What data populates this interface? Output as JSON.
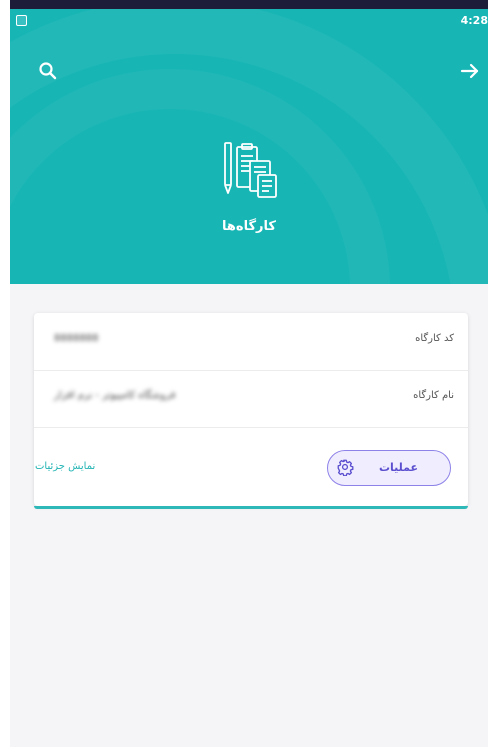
{
  "status_bar": {
    "time": "4:28"
  },
  "header": {
    "title": "کارگاه‌ها",
    "search_icon": "search-icon",
    "back_icon": "arrow-right-icon",
    "hero_icon": "documents-icon",
    "color": "#18b5b5"
  },
  "workshop_card": {
    "code_label": "کد کارگاه",
    "code_value": "8888888",
    "name_label": "نام کارگاه",
    "name_value": "فروشگاه کامپیوتر - نرم افزار",
    "operations_label": "عملیات",
    "operations_icon": "gear-icon",
    "details_label": "نمایش جزئیات",
    "accent_color": "#8d82e8",
    "link_color": "#21b3b3"
  }
}
